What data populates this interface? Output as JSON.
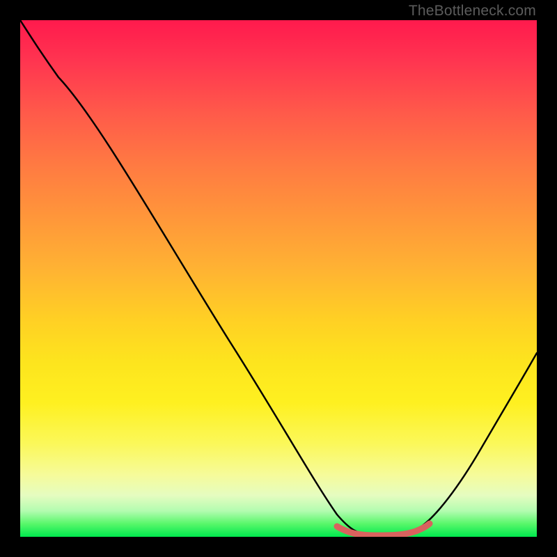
{
  "watermark": "TheBottleneck.com",
  "colors": {
    "curve": "#000000",
    "highlight": "#d9625e",
    "bg_top": "#ff1a4d",
    "bg_bottom": "#00e84e",
    "frame": "#000000"
  },
  "chart_data": {
    "type": "line",
    "title": "",
    "xlabel": "",
    "ylabel": "",
    "xlim": [
      0,
      100
    ],
    "ylim": [
      0,
      100
    ],
    "series": [
      {
        "name": "bottleneck-curve",
        "x": [
          0,
          3,
          8,
          15,
          25,
          35,
          45,
          55,
          60,
          63,
          66,
          70,
          74,
          77,
          80,
          84,
          90,
          95,
          100
        ],
        "y": [
          100,
          97,
          93,
          85,
          70,
          55,
          40,
          24,
          15,
          8,
          3,
          1,
          1,
          1,
          3,
          8,
          18,
          28,
          40
        ]
      }
    ],
    "highlight_segment": {
      "name": "near-zero-bottleneck",
      "x": [
        62,
        65,
        68,
        71,
        74,
        77,
        79
      ],
      "y": [
        3.5,
        2.0,
        1.2,
        1.0,
        1.0,
        1.2,
        2.5
      ]
    }
  }
}
